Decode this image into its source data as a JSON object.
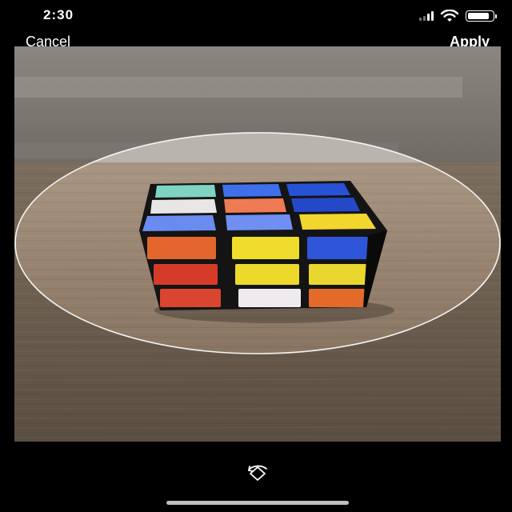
{
  "status": {
    "time": "2:30",
    "signal_icon": "cellular-signal-icon",
    "wifi_icon": "wifi-icon",
    "battery_icon": "battery-icon",
    "battery_level": 0.85
  },
  "toolbar": {
    "cancel_label": "Cancel",
    "apply_label": "Apply"
  },
  "photo": {
    "subject": "rubiks-cube-photo",
    "crop_mask": "ellipse"
  },
  "controls": {
    "rotate_icon": "rotate-icon"
  }
}
